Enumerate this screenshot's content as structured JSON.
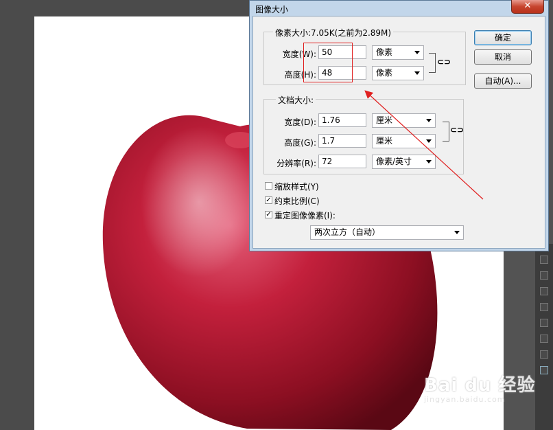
{
  "dialog": {
    "title": "图像大小",
    "close_glyph": "✕",
    "pixel_dimensions": {
      "title": "像素大小:7.05K(之前为2.89M)",
      "width_label": "宽度(W):",
      "width_value": "50",
      "width_unit": "像素",
      "height_label": "高度(H):",
      "height_value": "48",
      "height_unit": "像素"
    },
    "document_size": {
      "title": "文档大小:",
      "width_label": "宽度(D):",
      "width_value": "1.76",
      "width_unit": "厘米",
      "height_label": "高度(G):",
      "height_value": "1.7",
      "height_unit": "厘米",
      "resolution_label": "分辨率(R):",
      "resolution_value": "72",
      "resolution_unit": "像素/英寸"
    },
    "options": {
      "scale_styles_label": "缩放样式(Y)",
      "scale_styles_checked": false,
      "constrain_label": "约束比例(C)",
      "constrain_checked": true,
      "resample_label": "重定图像像素(I):",
      "resample_checked": true,
      "resample_method": "两次立方（自动）"
    },
    "buttons": {
      "ok": "确定",
      "cancel": "取消",
      "auto": "自动(A)..."
    },
    "check_glyph": "✓",
    "link_glyph": "⊂⊃"
  },
  "watermark": {
    "main": "Bai du 经验",
    "sub": "jingyan.baidu.com"
  },
  "colors": {
    "annotation": "#e02020",
    "dialog_frame": "#c2d6ea"
  }
}
